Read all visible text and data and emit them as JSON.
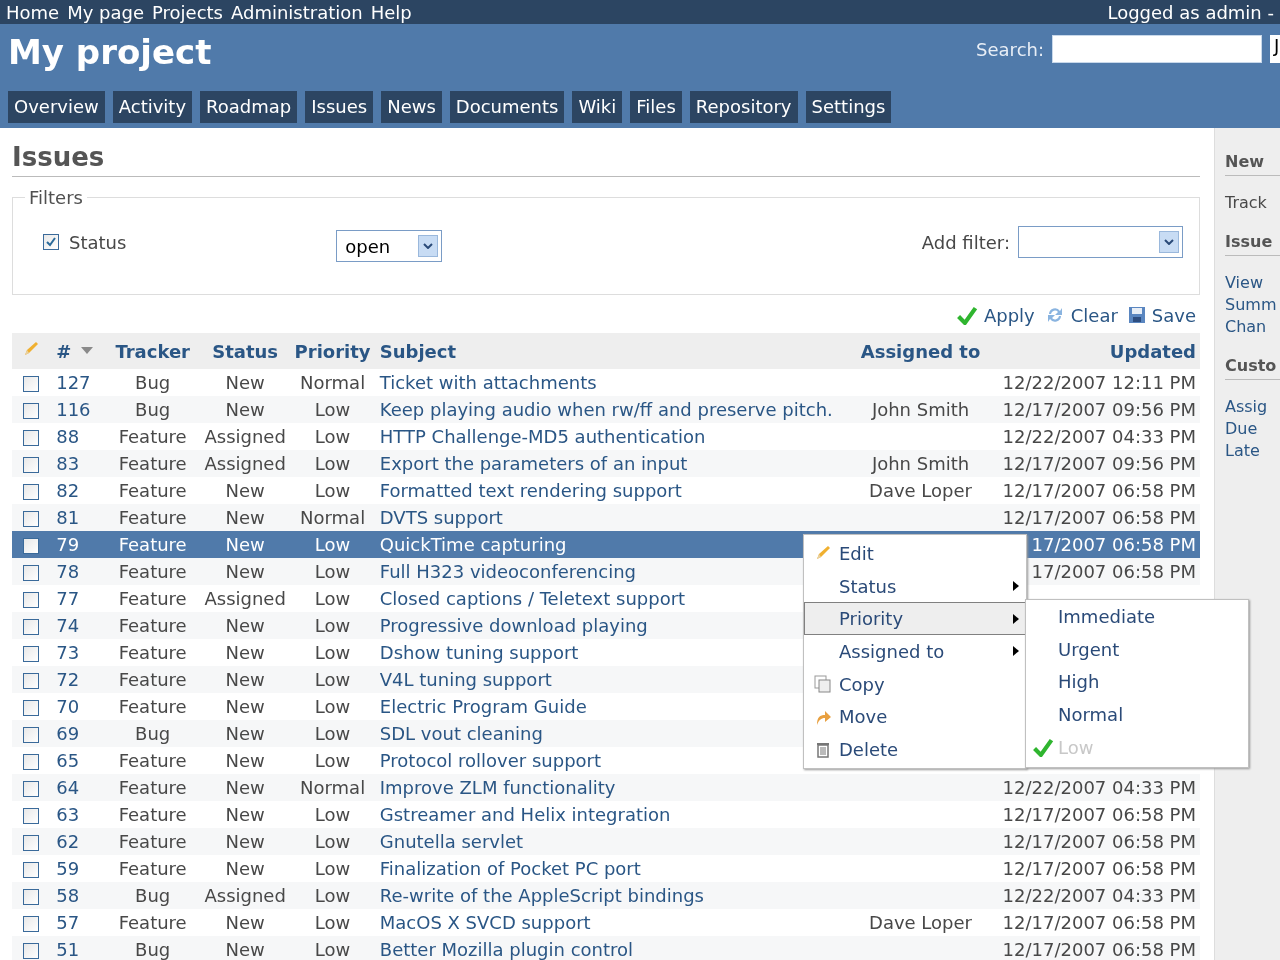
{
  "top_menu": [
    "Home",
    "My page",
    "Projects",
    "Administration",
    "Help"
  ],
  "logged_in": "Logged as admin -",
  "project_title": "My project",
  "search": {
    "label": "Search:",
    "jump_value": "J"
  },
  "tabs": [
    "Overview",
    "Activity",
    "Roadmap",
    "Issues",
    "News",
    "Documents",
    "Wiki",
    "Files",
    "Repository",
    "Settings"
  ],
  "page_title": "Issues",
  "filters": {
    "legend": "Filters",
    "status": {
      "label": "Status",
      "checked": true,
      "value": "open"
    },
    "add_filter_label": "Add filter:"
  },
  "actions": [
    {
      "label": "Apply",
      "kind": "apply"
    },
    {
      "label": "Clear",
      "kind": "clear"
    },
    {
      "label": "Save",
      "kind": "save"
    }
  ],
  "table": {
    "columns": [
      "#",
      "Tracker",
      "Status",
      "Priority",
      "Subject",
      "Assigned to",
      "Updated"
    ],
    "rows": [
      {
        "id": "127",
        "tracker": "Bug",
        "status": "New",
        "priority": "Normal",
        "subject": "Ticket with attachments",
        "updated": "12/22/2007 12:11 PM",
        "selected": false,
        "checked": false
      },
      {
        "id": "116",
        "tracker": "Bug",
        "status": "New",
        "priority": "Low",
        "subject": "Keep playing audio when rw/ff and preserve pitch.",
        "assigned_to": "John Smith",
        "updated": "12/17/2007 09:56 PM",
        "selected": false,
        "checked": false
      },
      {
        "id": "88",
        "tracker": "Feature",
        "status": "Assigned",
        "priority": "Low",
        "subject": "HTTP Challenge-MD5 authentication",
        "updated": "12/22/2007 04:33 PM",
        "selected": false,
        "checked": false
      },
      {
        "id": "83",
        "tracker": "Feature",
        "status": "Assigned",
        "priority": "Low",
        "subject": "Export the parameters of an input",
        "assigned_to": "John Smith",
        "updated": "12/17/2007 09:56 PM",
        "selected": false,
        "checked": false
      },
      {
        "id": "82",
        "tracker": "Feature",
        "status": "New",
        "priority": "Low",
        "subject": "Formatted text rendering support",
        "assigned_to": "Dave Loper",
        "updated": "12/17/2007 06:58 PM",
        "selected": false,
        "checked": false
      },
      {
        "id": "81",
        "tracker": "Feature",
        "status": "New",
        "priority": "Normal",
        "subject": "DVTS support",
        "updated": "12/17/2007 06:58 PM",
        "selected": false,
        "checked": false
      },
      {
        "id": "79",
        "tracker": "Feature",
        "status": "New",
        "priority": "Low",
        "subject": "QuickTime capturing",
        "updated": "17/2007 06:58 PM",
        "selected": true,
        "checked": false
      },
      {
        "id": "78",
        "tracker": "Feature",
        "status": "New",
        "priority": "Low",
        "subject": "Full H323 videoconferencing",
        "updated": "17/2007 06:58 PM",
        "selected": false,
        "checked": false
      },
      {
        "id": "77",
        "tracker": "Feature",
        "status": "Assigned",
        "priority": "Low",
        "subject": "Closed captions / Teletext support",
        "selected": false,
        "checked": false
      },
      {
        "id": "74",
        "tracker": "Feature",
        "status": "New",
        "priority": "Low",
        "subject": "Progressive download playing",
        "selected": false,
        "checked": false
      },
      {
        "id": "73",
        "tracker": "Feature",
        "status": "New",
        "priority": "Low",
        "subject": "Dshow tuning support",
        "selected": false,
        "checked": false
      },
      {
        "id": "72",
        "tracker": "Feature",
        "status": "New",
        "priority": "Low",
        "subject": "V4L tuning support",
        "selected": false,
        "checked": false
      },
      {
        "id": "70",
        "tracker": "Feature",
        "status": "New",
        "priority": "Low",
        "subject": "Electric Program Guide",
        "selected": false,
        "checked": false
      },
      {
        "id": "69",
        "tracker": "Bug",
        "status": "New",
        "priority": "Low",
        "subject": "SDL vout cleaning",
        "selected": false,
        "checked": false
      },
      {
        "id": "65",
        "tracker": "Feature",
        "status": "New",
        "priority": "Low",
        "subject": "Protocol rollover support",
        "selected": false,
        "checked": false
      },
      {
        "id": "64",
        "tracker": "Feature",
        "status": "New",
        "priority": "Normal",
        "subject": "Improve ZLM functionality",
        "updated": "12/22/2007 04:33 PM",
        "selected": false,
        "checked": false
      },
      {
        "id": "63",
        "tracker": "Feature",
        "status": "New",
        "priority": "Low",
        "subject": "Gstreamer and Helix integration",
        "updated": "12/17/2007 06:58 PM",
        "selected": false,
        "checked": false
      },
      {
        "id": "62",
        "tracker": "Feature",
        "status": "New",
        "priority": "Low",
        "subject": "Gnutella servlet",
        "updated": "12/17/2007 06:58 PM",
        "selected": false,
        "checked": false
      },
      {
        "id": "59",
        "tracker": "Feature",
        "status": "New",
        "priority": "Low",
        "subject": "Finalization of Pocket PC port",
        "updated": "12/17/2007 06:58 PM",
        "selected": false,
        "checked": false
      },
      {
        "id": "58",
        "tracker": "Bug",
        "status": "Assigned",
        "priority": "Low",
        "subject": "Re-write of the AppleScript bindings",
        "updated": "12/22/2007 04:33 PM",
        "selected": false,
        "checked": false
      },
      {
        "id": "57",
        "tracker": "Feature",
        "status": "New",
        "priority": "Low",
        "subject": "MacOS X SVCD support",
        "assigned_to": "Dave Loper",
        "updated": "12/17/2007 06:58 PM",
        "selected": false,
        "checked": false
      },
      {
        "id": "51",
        "tracker": "Bug",
        "status": "New",
        "priority": "Low",
        "subject": "Better Mozilla plugin control",
        "updated": "12/17/2007 06:58 PM",
        "selected": false,
        "checked": false
      }
    ]
  },
  "context_menu": {
    "items": [
      {
        "label": "Edit",
        "kind": "edit",
        "has_submenu": false,
        "selected": false
      },
      {
        "label": "Status",
        "kind": "plain",
        "has_submenu": true,
        "selected": false
      },
      {
        "label": "Priority",
        "kind": "plain",
        "has_submenu": true,
        "selected": true
      },
      {
        "label": "Assigned to",
        "kind": "plain",
        "has_submenu": true,
        "selected": false
      },
      {
        "label": "Copy",
        "kind": "copy",
        "has_submenu": false,
        "selected": false
      },
      {
        "label": "Move",
        "kind": "move",
        "has_submenu": false,
        "selected": false
      },
      {
        "label": "Delete",
        "kind": "delete",
        "has_submenu": false,
        "selected": false
      }
    ],
    "submenu": [
      {
        "label": "Immediate",
        "checked": false
      },
      {
        "label": "Urgent",
        "checked": false
      },
      {
        "label": "High",
        "checked": false
      },
      {
        "label": "Normal",
        "checked": false
      },
      {
        "label": "Low",
        "checked": true
      }
    ]
  },
  "sidebar": [
    {
      "heading": "New",
      "items": [
        {
          "label": "Track",
          "kind": "text"
        }
      ]
    },
    {
      "heading": "Issue",
      "items": [
        {
          "label": "View",
          "kind": "link"
        },
        {
          "label": "Summ",
          "kind": "link"
        },
        {
          "label": "Chan",
          "kind": "link"
        }
      ]
    },
    {
      "heading": "Custo",
      "items": [
        {
          "label": "Assig",
          "kind": "link"
        },
        {
          "label": "Due",
          "kind": "link"
        },
        {
          "label": "Late",
          "kind": "link"
        }
      ]
    }
  ]
}
